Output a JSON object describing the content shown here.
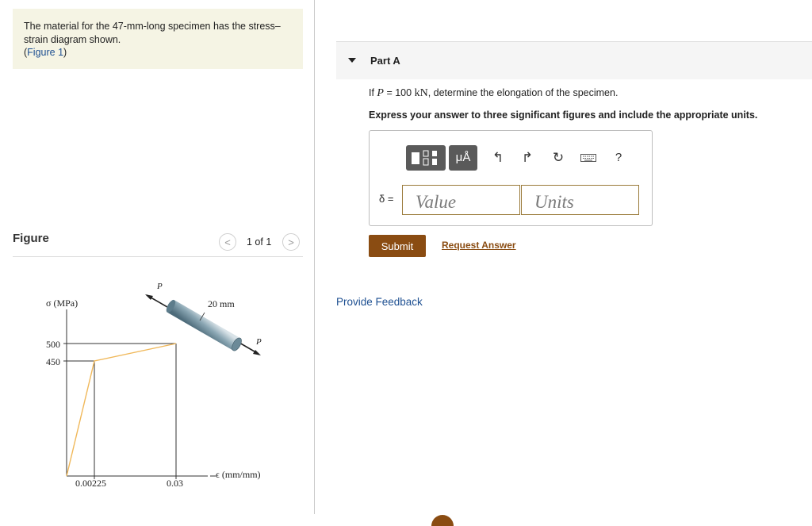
{
  "problem": {
    "intro_text": "The material for the 47-mm-long specimen has the stress–strain diagram shown.",
    "figure_link_open": "(",
    "figure_link": "Figure 1",
    "figure_link_close": ")"
  },
  "figure_panel": {
    "label": "Figure",
    "pager": "1 of 1",
    "prev_glyph": "<",
    "next_glyph": ">"
  },
  "diagram": {
    "stress_label": "σ (MPa)",
    "strain_label": "ϵ (mm/mm)",
    "y_ticks": [
      "500",
      "450"
    ],
    "x_ticks": [
      "0.00225",
      "0.03"
    ],
    "specimen_diameter": "20 mm",
    "load_top": "P",
    "load_bottom": "P",
    "curve_points": [
      [
        0,
        0
      ],
      [
        0.00225,
        450
      ],
      [
        0.03,
        500
      ]
    ],
    "colors": {
      "curve": "#f0b85a",
      "specimen": "#6e8e9e",
      "axis": "#333333"
    }
  },
  "part": {
    "title": "Part A",
    "question_prefix": "If ",
    "question_var": "P",
    "question_eq": " = 100 ",
    "question_unit": "kN",
    "question_suffix": ", determine the elongation of the specimen.",
    "instructions": "Express your answer to three significant figures and include the appropriate units."
  },
  "answer": {
    "delta_label": "δ =",
    "value_placeholder": "Value",
    "units_placeholder": "Units",
    "toolbar": {
      "units_button": "μÅ",
      "help": "?",
      "icons": [
        "template-icon",
        "units-icon",
        "undo-icon",
        "redo-icon",
        "reset-icon",
        "keyboard-icon",
        "help-icon"
      ]
    }
  },
  "actions": {
    "submit": "Submit",
    "request_answer": "Request Answer",
    "provide_feedback": "Provide Feedback"
  },
  "colors": {
    "accent": "#8a4c12",
    "link": "#1d4f91",
    "intro_bg": "#f5f4e4",
    "field_border": "#9a7a3a"
  }
}
